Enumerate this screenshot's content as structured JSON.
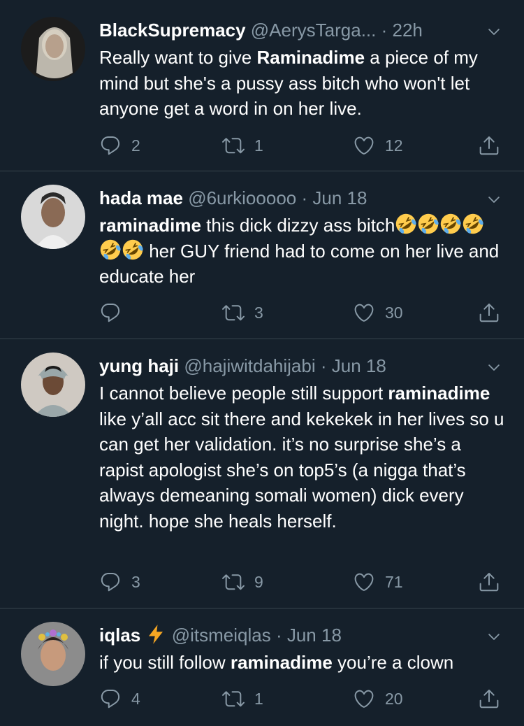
{
  "tweets": [
    {
      "name": "BlackSupremacy",
      "handle": "@AerysTarga...",
      "dot": "·",
      "time": "22h",
      "mention": "Raminadime",
      "text_before": "Really want to give ",
      "text_after": " a piece of my mind but she's a pussy ass bitch who won't let anyone get a word in on her live.",
      "replies": "2",
      "retweets": "1",
      "likes": "12"
    },
    {
      "name": "hada mae",
      "handle": "@6urkiooooo",
      "dot": "·",
      "time": "Jun 18",
      "mention": "raminadime",
      "text_before": "",
      "text_after": " this dick dizzy ass bitch",
      "text_end": " her GUY friend had to come on her live and educate her",
      "emoji_name": "rolling-on-floor-laughing-emoji",
      "replies": "",
      "retweets": "3",
      "likes": "30"
    },
    {
      "name": "yung haji",
      "handle": "@hajiwitdahijabi",
      "dot": "·",
      "time": "Jun 18",
      "mention": "raminadime",
      "text_before": "I cannot believe people still support ",
      "text_after": " like y’all acc sit there and kekekek in her lives so u can get her validation. it’s no surprise she’s a rapist apologist she’s on top5’s (a nigga that’s always demeaning somali women) dick every night. hope she heals herself.",
      "replies": "3",
      "retweets": "9",
      "likes": "71"
    },
    {
      "name": "iqlas",
      "handle": "@itsmeiqlas",
      "dot": "·",
      "time": "Jun 18",
      "mention": "raminadime",
      "text_before": "if you still follow ",
      "text_after": " you’re a clown",
      "replies": "4",
      "retweets": "1",
      "likes": "20"
    }
  ],
  "icons": {
    "reply": "reply-icon",
    "retweet": "retweet-icon",
    "like": "heart-icon",
    "share": "share-icon",
    "more": "chevron-down-icon",
    "bolt": "lightning-bolt-emoji"
  },
  "colors": {
    "background": "#15202b",
    "divider": "#38444d",
    "secondary_text": "#8899a6",
    "primary_text": "#ffffff",
    "bolt": "#f5a623"
  }
}
